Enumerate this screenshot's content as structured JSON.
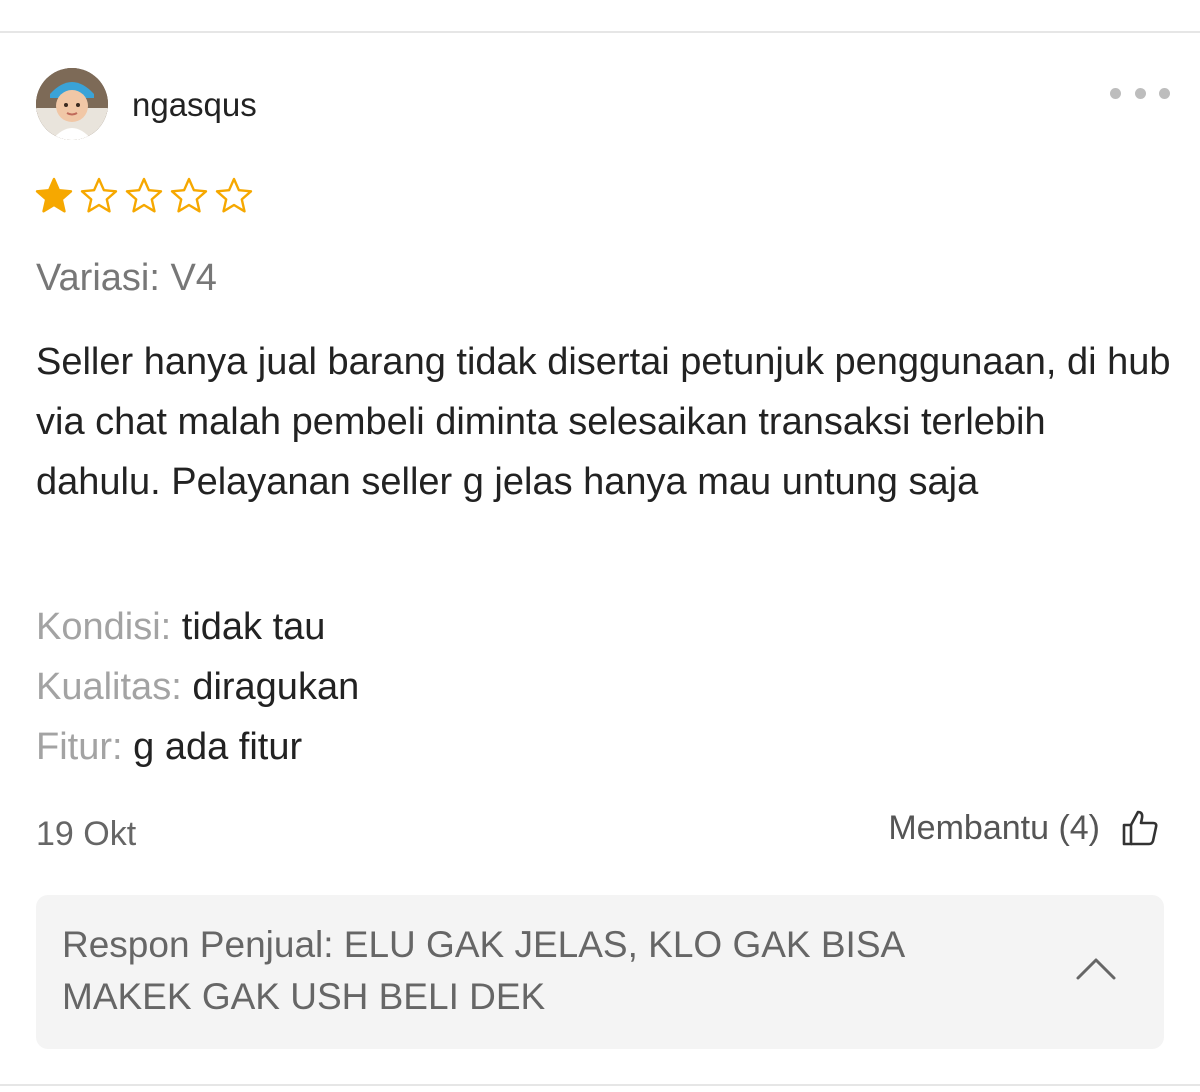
{
  "reviewer": {
    "username": "ngasqus",
    "avatar_icon": "baby-photo-avatar"
  },
  "rating": {
    "value": 1,
    "max": 5,
    "filled_color": "#f6a800",
    "empty_color": "#f6a800"
  },
  "variant": "Variasi: V4",
  "review_text": "Seller hanya jual barang tidak disertai petunjuk penggunaan, di hub via chat malah pembeli diminta selesaikan transaksi terlebih dahulu. Pelayanan seller g jelas hanya mau untung saja",
  "attributes": [
    {
      "label": "Kondisi:",
      "value": "tidak tau"
    },
    {
      "label": "Kualitas:",
      "value": "diragukan"
    },
    {
      "label": "Fitur:",
      "value": "g ada fitur"
    }
  ],
  "date": "19 Okt",
  "helpful": {
    "label": "Membantu (4)",
    "icon": "thumbs-up-icon"
  },
  "seller_response": {
    "text": "Respon Penjual: ELU GAK JELAS, KLO GAK BISA MAKEK GAK USH BELI DEK",
    "toggle_icon": "chevron-up-icon"
  },
  "more_icon": "more-horizontal-icon"
}
